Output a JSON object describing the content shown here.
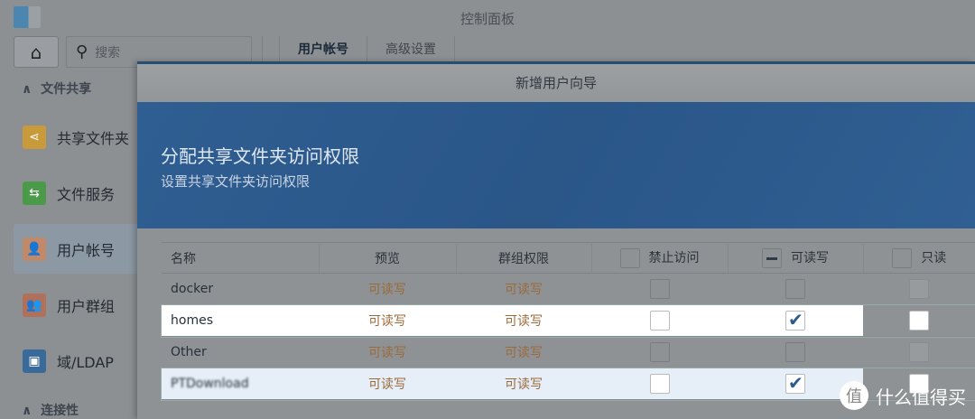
{
  "window": {
    "title": "控制面板"
  },
  "toolbar": {
    "search_placeholder": "搜索",
    "tabs": [
      "用户帐号",
      "高级设置"
    ]
  },
  "sidebar": {
    "section1": "文件共享",
    "items": [
      {
        "label": "共享文件夹"
      },
      {
        "label": "文件服务"
      },
      {
        "label": "用户帐号"
      },
      {
        "label": "用户群组"
      },
      {
        "label": "域/LDAP"
      }
    ],
    "section2": "连接性"
  },
  "dialog": {
    "title": "新增用户向导",
    "heading": "分配共享文件夹访问权限",
    "subheading": "设置共享文件夹访问权限",
    "columns": [
      "名称",
      "预览",
      "群组权限",
      "禁止访问",
      "可读写",
      "只读"
    ],
    "rows": [
      {
        "name": "docker",
        "preview": "可读写",
        "group": "可读写",
        "deny": false,
        "rw": false,
        "ro": false
      },
      {
        "name": "homes",
        "preview": "可读写",
        "group": "可读写",
        "deny": false,
        "rw": true,
        "ro": false
      },
      {
        "name": "Other",
        "preview": "可读写",
        "group": "可读写",
        "deny": false,
        "rw": false,
        "ro": false
      },
      {
        "name": "PTDownload",
        "preview": "可读写",
        "group": "可读写",
        "deny": false,
        "rw": true,
        "ro": false
      }
    ]
  },
  "watermark": {
    "logo": "值",
    "text": "什么值得买"
  }
}
